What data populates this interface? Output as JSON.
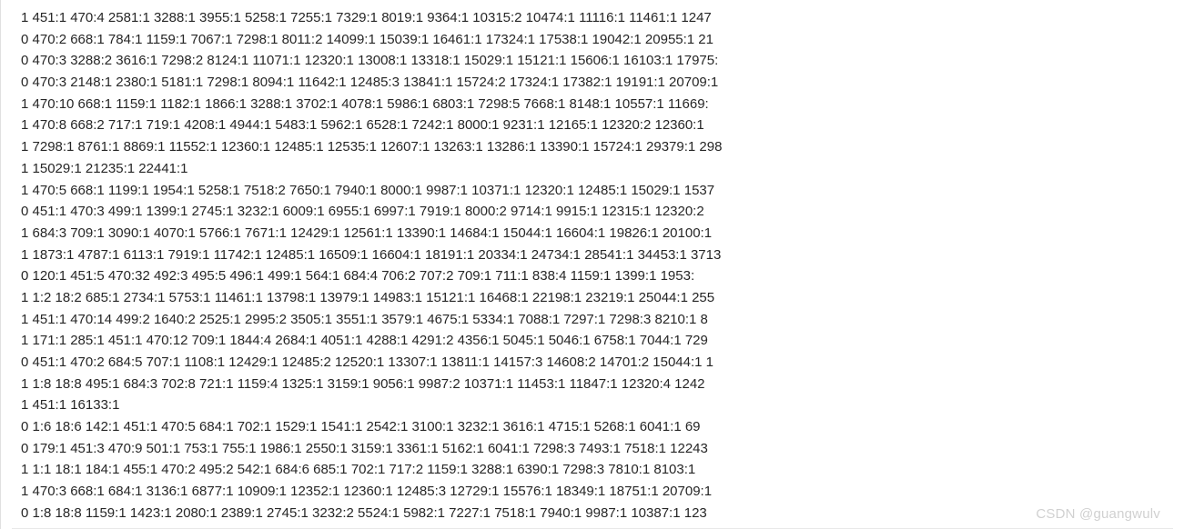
{
  "watermark": "CSDN @guangwulv",
  "lines": [
    "1 451:1 470:4 2581:1 3288:1 3955:1 5258:1 7255:1 7329:1 8019:1 9364:1 10315:2 10474:1 11116:1 11461:1 1247",
    "0 470:2 668:1 784:1 1159:1 7067:1 7298:1 8011:2 14099:1 15039:1 16461:1 17324:1 17538:1 19042:1 20955:1 21",
    "0 470:3 3288:2 3616:1 7298:2 8124:1 11071:1 12320:1 13008:1 13318:1 15029:1 15121:1 15606:1 16103:1 17975:",
    "0 470:3 2148:1 2380:1 5181:1 7298:1 8094:1 11642:1 12485:3 13841:1 15724:2 17324:1 17382:1 19191:1 20709:1",
    "1 470:10 668:1 1159:1 1182:1 1866:1 3288:1 3702:1 4078:1 5986:1 6803:1 7298:5 7668:1 8148:1 10557:1 11669:",
    "1 470:8 668:2 717:1 719:1 4208:1 4944:1 5483:1 5962:1 6528:1 7242:1 8000:1 9231:1 12165:1 12320:2 12360:1",
    "1 7298:1 8761:1 8869:1 11552:1 12360:1 12485:1 12535:1 12607:1 13263:1 13286:1 13390:1 15724:1 29379:1 298",
    "1 15029:1 21235:1 22441:1",
    "1 470:5 668:1 1199:1 1954:1 5258:1 7518:2 7650:1 7940:1 8000:1 9987:1 10371:1 12320:1 12485:1 15029:1 1537",
    "0 451:1 470:3 499:1 1399:1 2745:1 3232:1 6009:1 6955:1 6997:1 7919:1 8000:2 9714:1 9915:1 12315:1 12320:2",
    "1 684:3 709:1 3090:1 4070:1 5766:1 7671:1 12429:1 12561:1 13390:1 14684:1 15044:1 16604:1 19826:1 20100:1",
    "1 1873:1 4787:1 6113:1 7919:1 11742:1 12485:1 16509:1 16604:1 18191:1 20334:1 24734:1 28541:1 34453:1 3713",
    "0 120:1 451:5 470:32 492:3 495:5 496:1 499:1 564:1 684:4 706:2 707:2 709:1 711:1 838:4 1159:1 1399:1 1953:",
    "1 1:2 18:2 685:1 2734:1 5753:1 11461:1 13798:1 13979:1 14983:1 15121:1 16468:1 22198:1 23219:1 25044:1 255",
    "1 451:1 470:14 499:2 1640:2 2525:1 2995:2 3505:1 3551:1 3579:1 4675:1 5334:1 7088:1 7297:1 7298:3 8210:1 8",
    "1 171:1 285:1 451:1 470:12 709:1 1844:4 2684:1 4051:1 4288:1 4291:2 4356:1 5045:1 5046:1 6758:1 7044:1 729",
    "0 451:1 470:2 684:5 707:1 1108:1 12429:1 12485:2 12520:1 13307:1 13811:1 14157:3 14608:2 14701:2 15044:1 1",
    "1 1:8 18:8 495:1 684:3 702:8 721:1 1159:4 1325:1 3159:1 9056:1 9987:2 10371:1 11453:1 11847:1 12320:4 1242",
    "1 451:1 16133:1",
    "0 1:6 18:6 142:1 451:1 470:5 684:1 702:1 1529:1 1541:1 2542:1 3100:1 3232:1 3616:1 4715:1 5268:1 6041:1 69",
    "0 179:1 451:3 470:9 501:1 753:1 755:1 1986:1 2550:1 3159:1 3361:1 5162:1 6041:1 7298:3 7493:1 7518:1 12243",
    "1 1:1 18:1 184:1 455:1 470:2 495:2 542:1 684:6 685:1 702:1 717:2 1159:1 3288:1 6390:1 7298:3 7810:1 8103:1",
    "1 470:3 668:1 684:1 3136:1 6877:1 10909:1 12352:1 12360:1 12485:3 12729:1 15576:1 18349:1 18751:1 20709:1",
    "0 1:8 18:8 1159:1 1423:1 2080:1 2389:1 2745:1 3232:2 5524:1 5982:1 7227:1 7518:1 7940:1 9987:1 10387:1 123"
  ]
}
